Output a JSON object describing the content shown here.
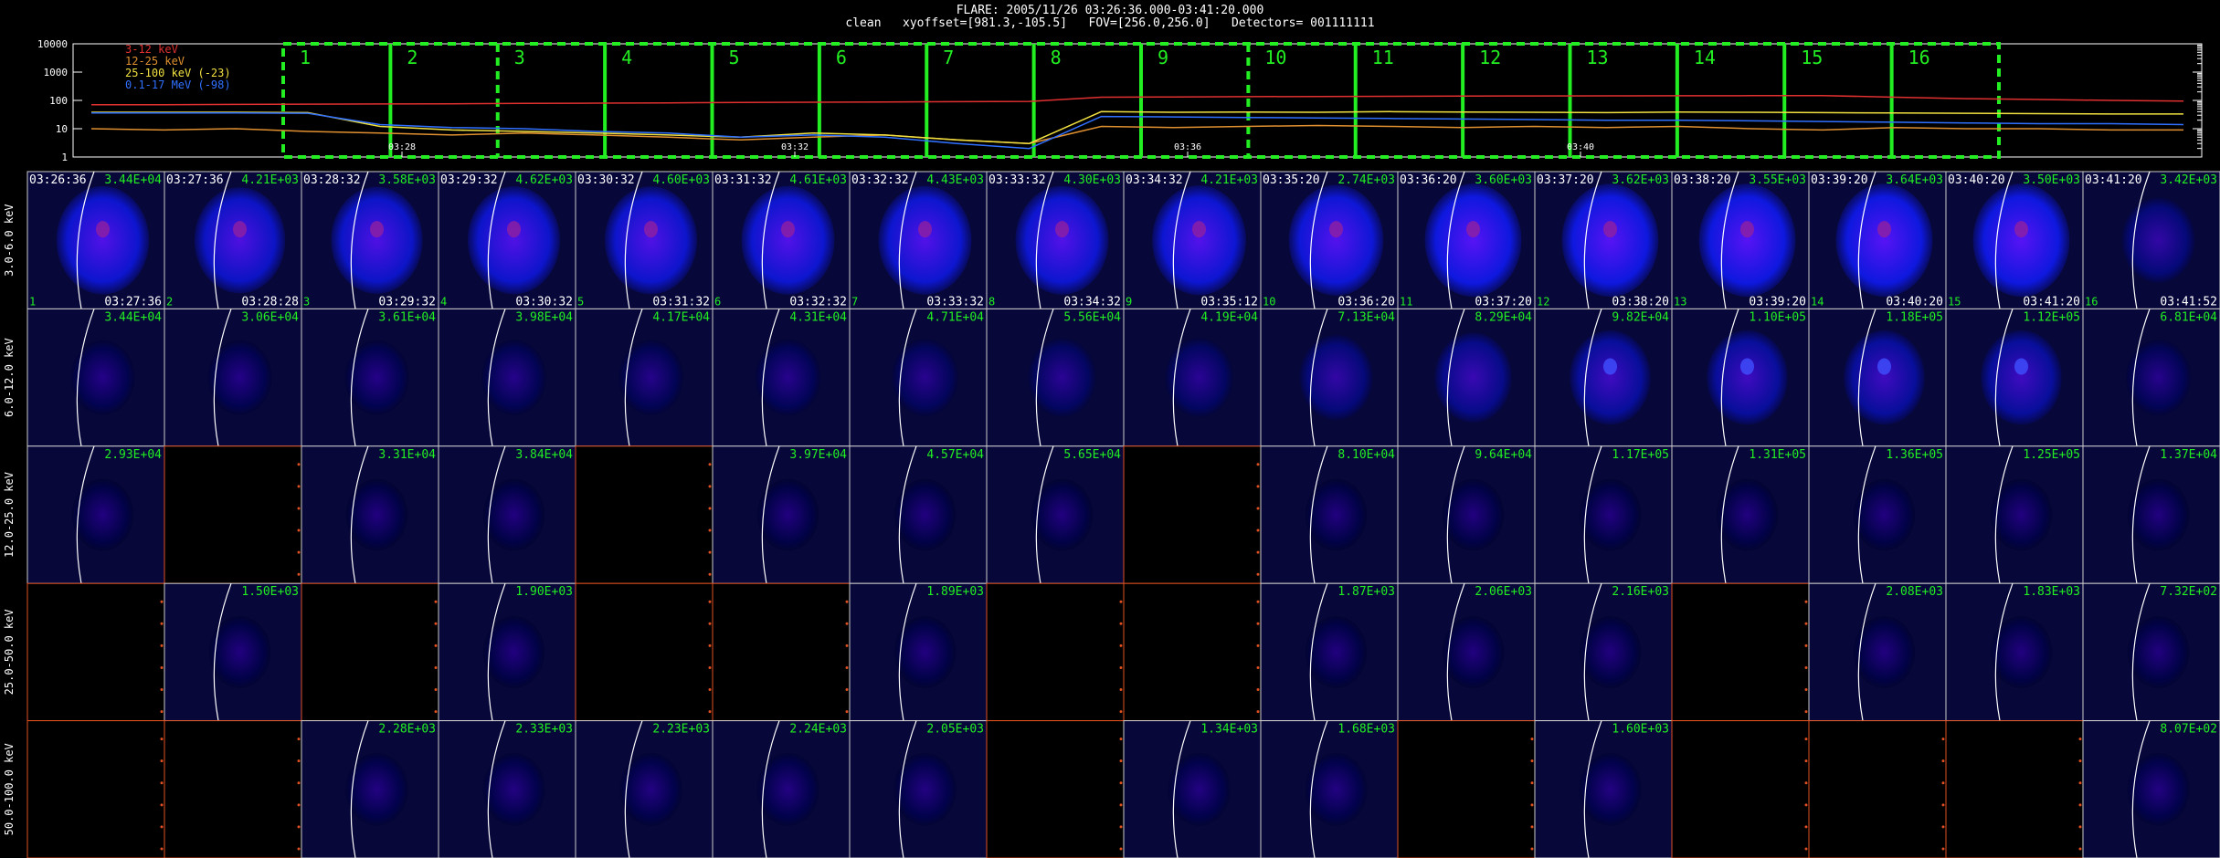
{
  "header": {
    "title": "FLARE: 2005/11/26 03:26:36.000-03:41:20.000",
    "subtitle": "clean   xyoffset=[981.3,-105.5]   FOV=[256.0,256.0]   Detectors= 001111111"
  },
  "chart_data": [
    {
      "type": "line",
      "scale": "log",
      "ylim": [
        1,
        10000
      ],
      "yticks": [
        "10000",
        "1000",
        "100",
        "10",
        "1"
      ],
      "xticks": [
        "03:28",
        "03:32",
        "03:36",
        "03:40"
      ],
      "legend_position": "top-left",
      "series": [
        {
          "name": "3-12 keV",
          "color": "#e03030",
          "values": [
            70,
            70,
            72,
            74,
            75,
            76,
            78,
            80,
            82,
            84,
            86,
            88,
            90,
            92,
            130,
            133,
            136,
            138,
            140,
            142,
            144,
            145,
            146,
            147,
            148,
            130,
            115,
            108,
            100,
            95
          ]
        },
        {
          "name": "12-25 keV",
          "color": "#e09030",
          "values": [
            10,
            9,
            10,
            8,
            7,
            6,
            7,
            6,
            5,
            4,
            5,
            6,
            4,
            3,
            12,
            11,
            12,
            13,
            12,
            11,
            12,
            11,
            12,
            10,
            9,
            11,
            10,
            10,
            9,
            9
          ]
        },
        {
          "name": "25-100 keV (-23)",
          "color": "#f0e040",
          "values": [
            38,
            38,
            38,
            37,
            12,
            9,
            8,
            7,
            6,
            5,
            7,
            6,
            4,
            3,
            40,
            38,
            39,
            38,
            40,
            39,
            38,
            37,
            39,
            38,
            37,
            36,
            35,
            34,
            33,
            33
          ]
        },
        {
          "name": "0.1-17 MeV (-98)",
          "color": "#3070ff",
          "values": [
            36,
            36,
            36,
            35,
            14,
            11,
            10,
            8,
            7,
            5,
            6,
            5,
            3,
            2,
            27,
            26,
            25,
            24,
            23,
            22,
            21,
            20,
            20,
            19,
            18,
            17,
            16,
            15,
            15,
            14
          ]
        }
      ],
      "intervals": [
        "1",
        "2",
        "3",
        "4",
        "5",
        "6",
        "7",
        "8",
        "9",
        "10",
        "11",
        "12",
        "13",
        "14",
        "15",
        "16"
      ]
    },
    {
      "type": "heatmap",
      "energy_bands": [
        "3.0-6.0 keV",
        "6.0-12.0 keV",
        "12.0-25.0 keV",
        "25.0-50.0 keV",
        "50.0-100.0 keV"
      ],
      "start_times": [
        "03:26:36",
        "03:27:36",
        "03:28:32",
        "03:29:32",
        "03:30:32",
        "03:31:32",
        "03:32:32",
        "03:33:32",
        "03:34:32",
        "03:35:20",
        "03:36:20",
        "03:37:20",
        "03:38:20",
        "03:39:20",
        "03:40:20",
        "03:41:20"
      ],
      "end_times": [
        "03:27:36",
        "03:28:28",
        "03:29:32",
        "03:30:32",
        "03:31:32",
        "03:32:32",
        "03:33:32",
        "03:34:32",
        "03:35:12",
        "03:36:20",
        "03:37:20",
        "03:38:20",
        "03:39:20",
        "03:40:20",
        "03:41:20",
        "03:41:52"
      ],
      "panel_numbers": [
        "1",
        "2",
        "3",
        "4",
        "5",
        "6",
        "7",
        "8",
        "9",
        "10",
        "11",
        "12",
        "13",
        "14",
        "15",
        "16"
      ],
      "rows": [
        {
          "maxima": [
            "3.44E+04",
            "4.21E+03",
            "3.58E+03",
            "4.62E+03",
            "4.60E+03",
            "4.61E+03",
            "4.43E+03",
            "4.30E+03",
            "4.21E+03",
            "2.74E+03",
            "3.60E+03",
            "3.62E+03",
            "3.55E+03",
            "3.64E+03",
            "3.50E+03",
            "3.42E+03"
          ],
          "intensity": [
            0.85,
            0.8,
            0.82,
            0.84,
            0.84,
            0.86,
            0.86,
            0.86,
            0.88,
            0.9,
            0.95,
            0.95,
            0.95,
            0.95,
            0.95,
            0.35
          ],
          "blank": [
            0,
            0,
            0,
            0,
            0,
            0,
            0,
            0,
            0,
            0,
            0,
            0,
            0,
            0,
            0,
            0
          ]
        },
        {
          "maxima": [
            "3.44E+04",
            "3.06E+04",
            "3.61E+04",
            "3.98E+04",
            "4.17E+04",
            "4.31E+04",
            "4.71E+04",
            "5.56E+04",
            "4.19E+04",
            "7.13E+04",
            "8.29E+04",
            "9.82E+04",
            "1.10E+05",
            "1.18E+05",
            "1.12E+05",
            "6.81E+04"
          ],
          "intensity": [
            0.12,
            0.12,
            0.12,
            0.14,
            0.14,
            0.16,
            0.18,
            0.22,
            0.22,
            0.35,
            0.45,
            0.55,
            0.55,
            0.55,
            0.55,
            0.15
          ],
          "blank": [
            0,
            0,
            0,
            0,
            0,
            0,
            0,
            0,
            0,
            0,
            0,
            0,
            0,
            0,
            0,
            0
          ]
        },
        {
          "maxima": [
            "2.93E+04",
            "",
            "3.31E+04",
            "3.84E+04",
            "",
            "3.97E+04",
            "4.57E+04",
            "5.65E+04",
            "",
            "8.10E+04",
            "9.64E+04",
            "1.17E+05",
            "1.31E+05",
            "1.36E+05",
            "1.25E+05",
            "1.37E+04"
          ],
          "intensity": [
            0.06,
            0,
            0.06,
            0.06,
            0,
            0.06,
            0.06,
            0.06,
            0,
            0.06,
            0.06,
            0.06,
            0.06,
            0.06,
            0.06,
            0.06
          ],
          "blank": [
            0,
            1,
            0,
            0,
            1,
            0,
            0,
            0,
            1,
            0,
            0,
            0,
            0,
            0,
            0,
            0
          ]
        },
        {
          "maxima": [
            "",
            "1.50E+03",
            "",
            "1.90E+03",
            "",
            "",
            "1.89E+03",
            "",
            "",
            "1.87E+03",
            "2.06E+03",
            "2.16E+03",
            "",
            "2.08E+03",
            "1.83E+03",
            "7.32E+02"
          ],
          "intensity": [
            0,
            0.06,
            0,
            0.06,
            0,
            0,
            0.06,
            0,
            0,
            0.06,
            0.06,
            0.06,
            0,
            0.06,
            0.06,
            0.06
          ],
          "blank": [
            1,
            0,
            1,
            0,
            1,
            1,
            0,
            1,
            1,
            0,
            0,
            0,
            1,
            0,
            0,
            0
          ]
        },
        {
          "maxima": [
            "",
            "",
            "2.28E+03",
            "2.33E+03",
            "2.23E+03",
            "2.24E+03",
            "2.05E+03",
            "",
            "1.34E+03",
            "1.68E+03",
            "",
            "1.60E+03",
            "",
            "",
            "",
            "8.07E+02"
          ],
          "intensity": [
            0,
            0,
            0.08,
            0.08,
            0.08,
            0.08,
            0.08,
            0,
            0.08,
            0.08,
            0,
            0.08,
            0,
            0,
            0,
            0.08
          ],
          "blank": [
            1,
            1,
            0,
            0,
            0,
            0,
            0,
            1,
            0,
            0,
            1,
            0,
            1,
            1,
            1,
            0
          ]
        }
      ]
    }
  ]
}
